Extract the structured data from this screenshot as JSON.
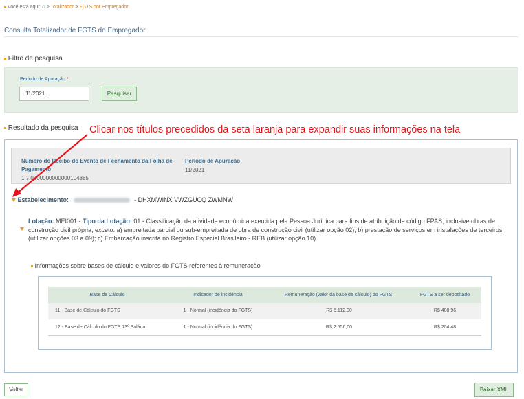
{
  "breadcrumb": {
    "prefix": "Você está aqui:",
    "link1": "Totalizador",
    "sep": ">",
    "link2": "FGTS por Empregador"
  },
  "page_title": "Consulta Totalizador de FGTS do Empregador",
  "filter": {
    "label": "Filtro de pesquisa",
    "periodo_label": "Período de Apuração",
    "required_mark": "*",
    "periodo_value": "11/2021",
    "search_button": "Pesquisar"
  },
  "annotation": "Clicar nos títulos precedidos da seta laranja para expandir suas informações na tela",
  "result": {
    "label": "Resultado da pesquisa",
    "recibo_header": "Número do Recibo do Evento de Fechamento da Folha de Pagamento",
    "recibo_value": "1.7.0000000000000104885",
    "periodo_header": "Período de Apuração",
    "periodo_value": "11/2021",
    "estab_label": "Estabelecimento:",
    "estab_name": "- DHXMWINX VWZGUCQ ZWMNW",
    "lotacao_label": "Lotação:",
    "lotacao_code": "MEI001 -",
    "tipo_label": "Tipo da Lotação:",
    "tipo_text": "01 - Classificação da atividade econômica exercida pela Pessoa Jurídica para fins de atribuição de código FPAS, inclusive obras de construção civil própria, exceto: a) empreitada parcial ou sub-empreitada de obra de construção civil (utilizar opção 02); b) prestação de serviços em instalações de terceiros (utilizar opções 03 a 09); c) Embarcação inscrita no Registro Especial Brasileiro - REB (utilizar opção 10)",
    "info_label": "Informações sobre bases de cálculo e valores do FGTS referentes à remuneração",
    "table": {
      "headers": [
        "Base de Cálculo",
        "Indicador de incidência",
        "Remuneração (valor da base de cálculo) do FGTS.",
        "FGTS a ser depositado"
      ],
      "rows": [
        [
          "11 - Base de Cálculo do FGTS",
          "1 - Normal (incidência do FGTS)",
          "R$ 5.112,00",
          "R$ 408,96"
        ],
        [
          "12 - Base de Cálculo do FGTS 13º Salário",
          "1 - Normal (incidência do FGTS)",
          "R$ 2.556,00",
          "R$ 204,48"
        ]
      ]
    }
  },
  "footer": {
    "back_button": "Voltar",
    "xml_button": "Baixar XML"
  },
  "colors": {
    "accent_orange": "#e8a317",
    "annotation_red": "#e8141b",
    "green_bg": "#e6efe6",
    "header_blue": "#3c6e91"
  }
}
